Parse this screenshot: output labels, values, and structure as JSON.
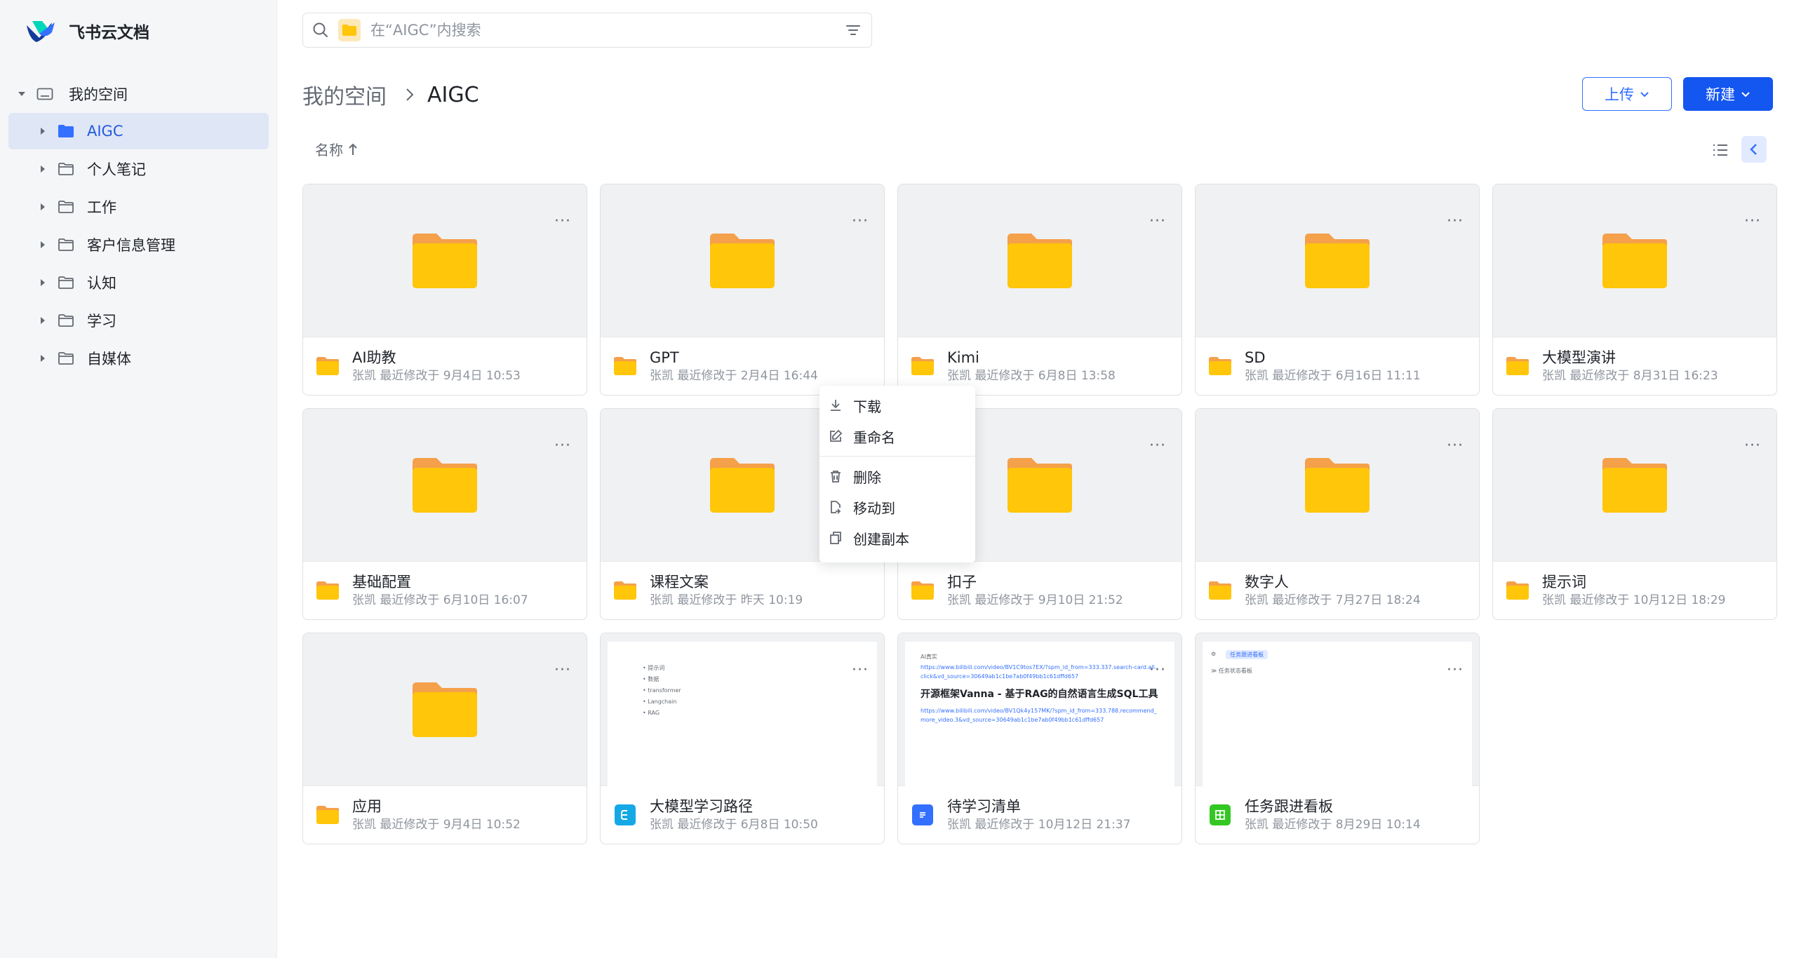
{
  "app": {
    "name": "飞书云文档"
  },
  "sidebar": {
    "root_label": "我的空间",
    "items": [
      {
        "label": "AIGC",
        "active": true
      },
      {
        "label": "个人笔记",
        "active": false
      },
      {
        "label": "工作",
        "active": false
      },
      {
        "label": "客户信息管理",
        "active": false
      },
      {
        "label": "认知",
        "active": false
      },
      {
        "label": "学习",
        "active": false
      },
      {
        "label": "自媒体",
        "active": false
      }
    ]
  },
  "search": {
    "placeholder": "在“AIGC”内搜索"
  },
  "breadcrumb": {
    "root": "我的空间",
    "current": "AIGC"
  },
  "toolbar": {
    "upload_label": "上传",
    "new_label": "新建"
  },
  "sort": {
    "label": "名称"
  },
  "cards": [
    {
      "name": "AI助教",
      "meta": "张凯 最近修改于 9月4日 10:53",
      "kind": "folder"
    },
    {
      "name": "GPT",
      "meta": "张凯 最近修改于 2月4日 16:44",
      "kind": "folder"
    },
    {
      "name": "Kimi",
      "meta": "张凯 最近修改于 6月8日 13:58",
      "kind": "folder"
    },
    {
      "name": "SD",
      "meta": "张凯 最近修改于 6月16日 11:11",
      "kind": "folder"
    },
    {
      "name": "大模型演讲",
      "meta": "张凯 最近修改于 8月31日 16:23",
      "kind": "folder"
    },
    {
      "name": "基础配置",
      "meta": "张凯 最近修改于 6月10日 16:07",
      "kind": "folder"
    },
    {
      "name": "课程文案",
      "meta": "张凯 最近修改于 昨天 10:19",
      "kind": "folder"
    },
    {
      "name": "扣子",
      "meta": "张凯 最近修改于 9月10日 21:52",
      "kind": "folder"
    },
    {
      "name": "数字人",
      "meta": "张凯 最近修改于 7月27日 18:24",
      "kind": "folder"
    },
    {
      "name": "提示词",
      "meta": "张凯 最近修改于 10月12日 18:29",
      "kind": "folder"
    },
    {
      "name": "应用",
      "meta": "张凯 最近修改于 9月4日 10:52",
      "kind": "folder"
    },
    {
      "name": "大模型学习路径",
      "meta": "张凯 最近修改于 6月8日 10:50",
      "kind": "mindnote"
    },
    {
      "name": "待学习清单",
      "meta": "张凯 最近修改于 10月12日 21:37",
      "kind": "doc"
    },
    {
      "name": "任务跟进看板",
      "meta": "张凯 最近修改于 8月29日 10:14",
      "kind": "sheet"
    }
  ],
  "thumbs": {
    "mindmap_items": [
      "提示词",
      "数据",
      "transformer",
      "Langchain",
      "RAG"
    ],
    "doc_heading": "AI真实",
    "doc_link1": "https://www.bilibili.com/video/BV1C9tos7EX/?spm_id_from=333.337.search-card.all.click&vd_source=30649ab1c1be7ab0f49bb1c61dffd657",
    "doc_title": "开源框架Vanna - 基于RAG的自然语言生成SQL工具",
    "doc_link2": "https://www.bilibili.com/video/BV1Qk4y157MK/?spm_id_from=333.788.recommend_more_video.3&vd_source=30649ab1c1be7ab0f49bb1c61dffd657",
    "sheet_tab": "任务跟进看板",
    "sheet_row": "任务状态看板"
  },
  "context_menu": {
    "items": [
      "下载",
      "重命名",
      "删除",
      "移动到",
      "创建副本"
    ]
  },
  "colors": {
    "accent": "#3370ff",
    "primary_button": "#1456f0",
    "folder": "#ffc60a",
    "folder_tab": "#f5a04a"
  },
  "icons": [
    "folder-icon",
    "search-icon",
    "filter-icon",
    "list-view-icon",
    "collapse-icon",
    "more-icon"
  ]
}
